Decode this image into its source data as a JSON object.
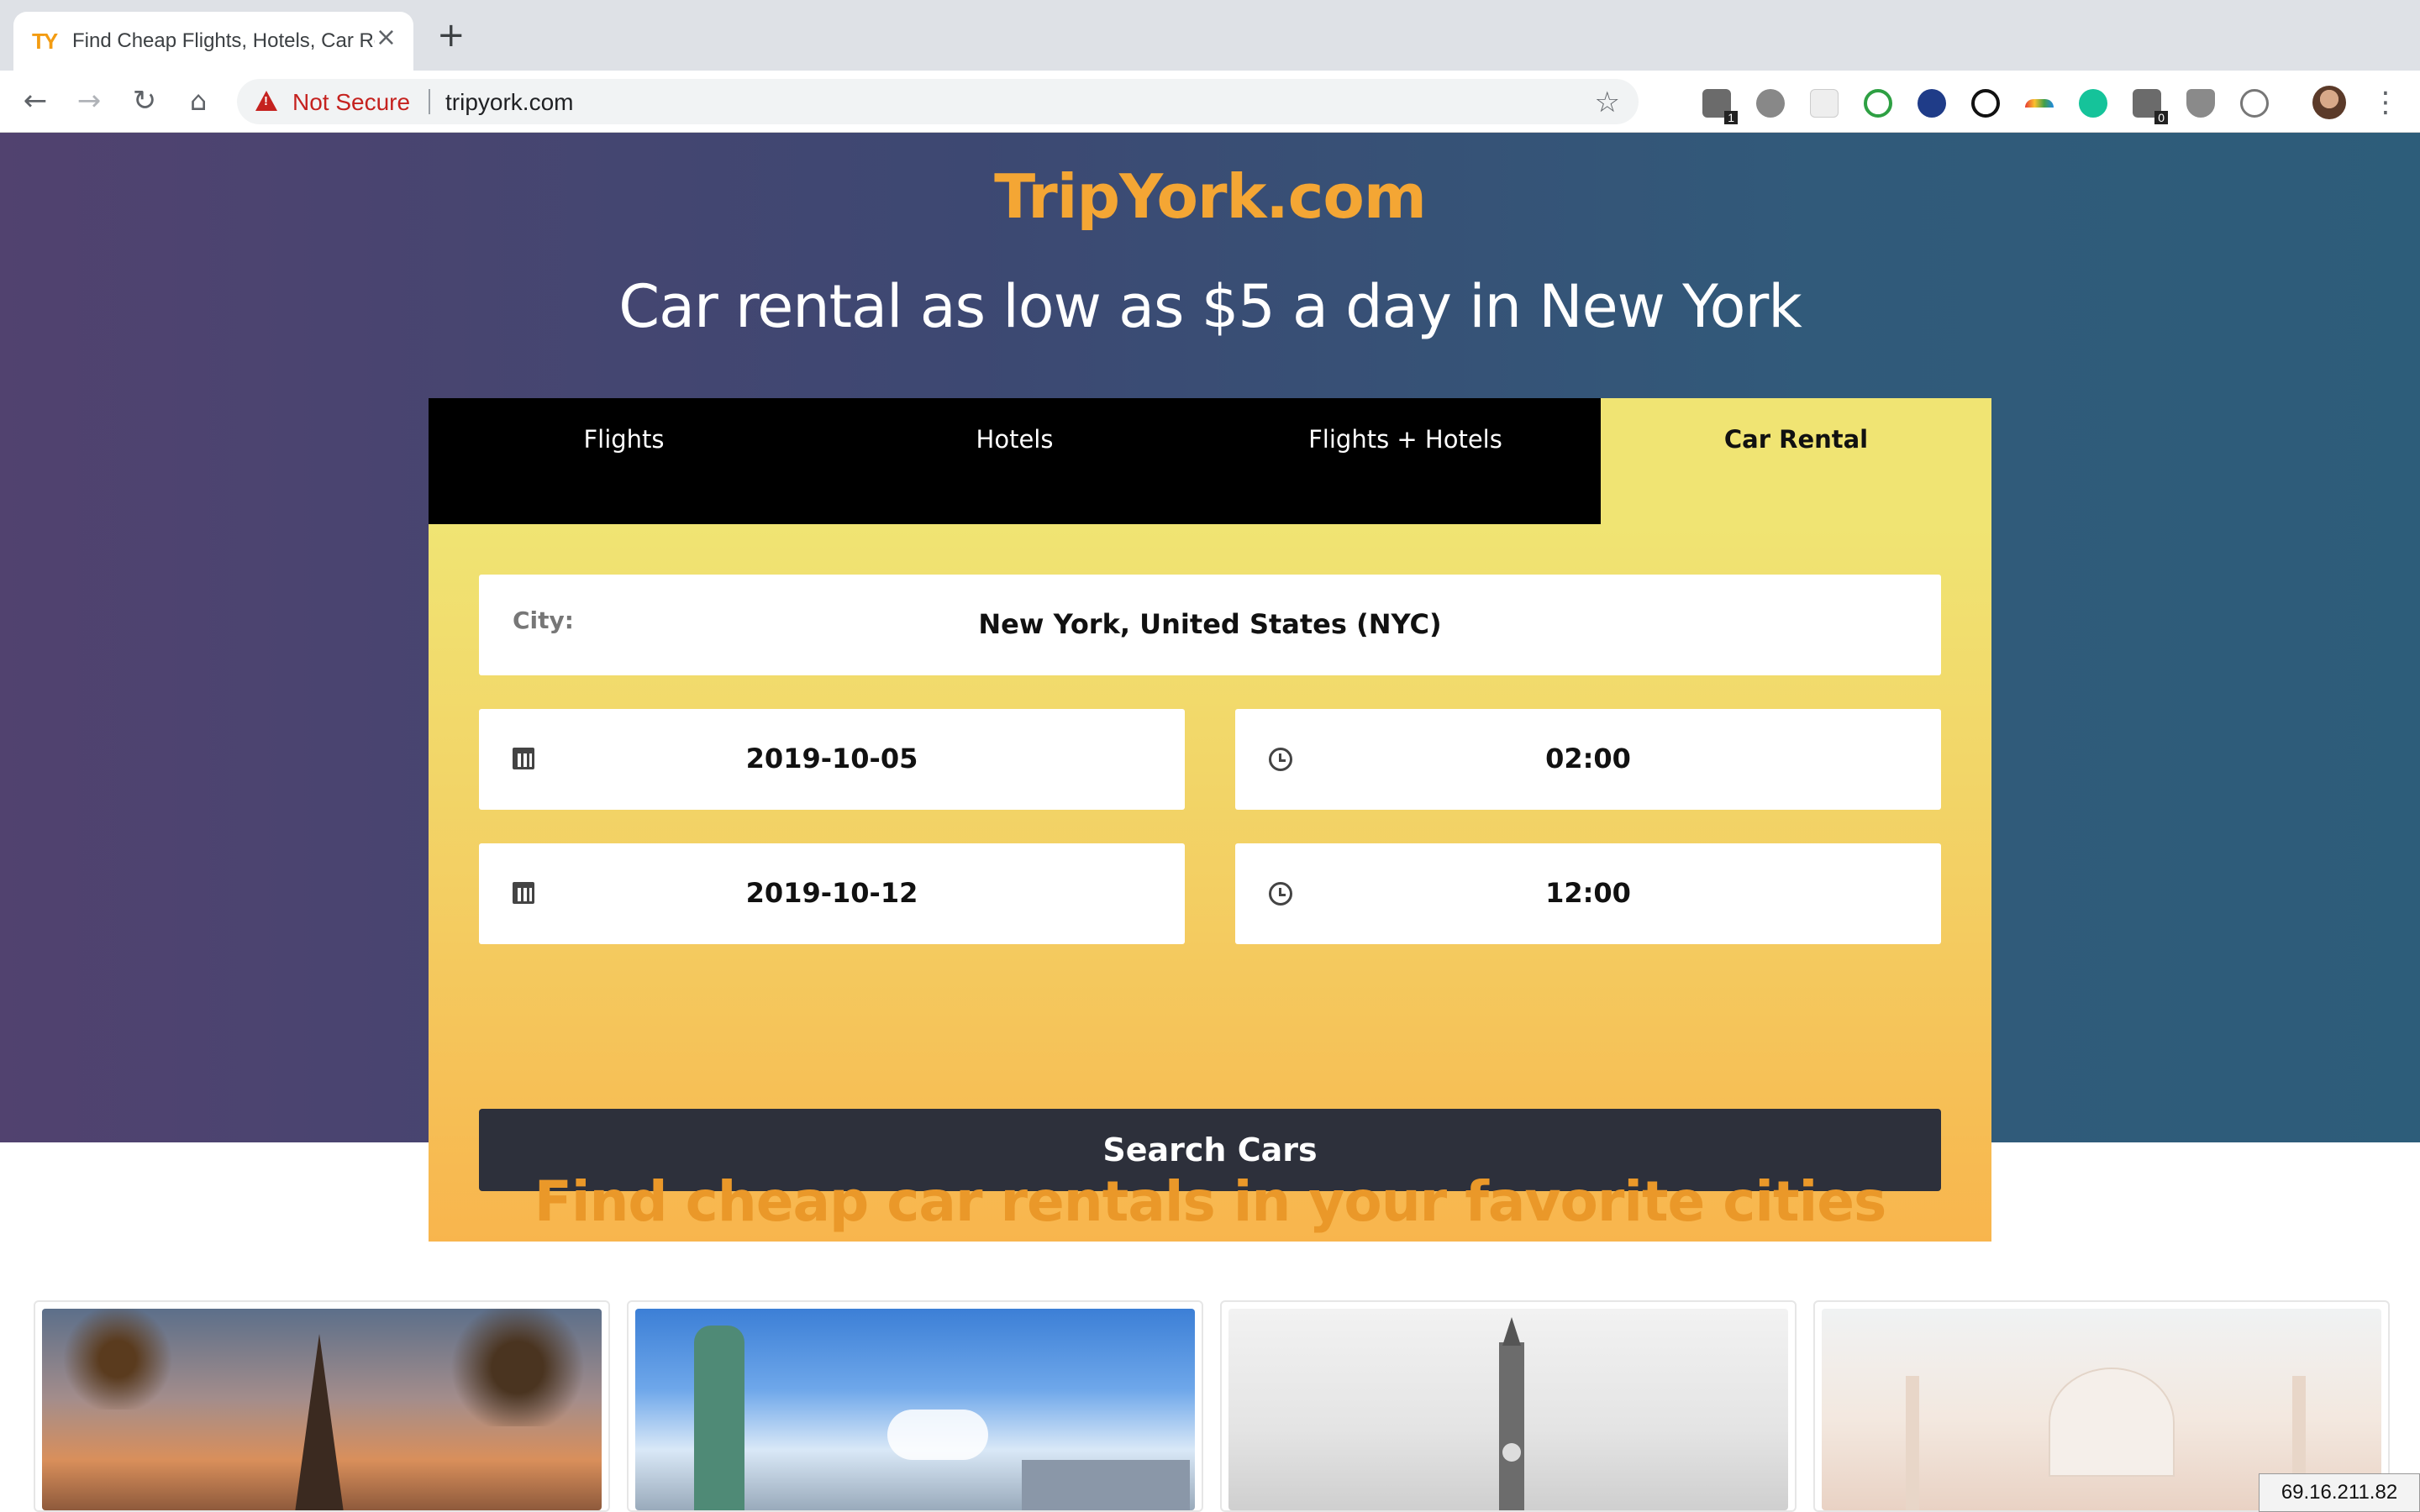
{
  "browser": {
    "tab_title": "Find Cheap Flights, Hotels, Car Rentals",
    "tab_favicon_text": "TY",
    "tab_close": "×",
    "new_tab": "+",
    "security_label": "Not Secure",
    "url": "tripyork.com",
    "extension_badges": [
      "1",
      "0"
    ]
  },
  "hero": {
    "brand": "TripYork.com",
    "headline": "Car rental as low as $5 a day in New York",
    "tabs": [
      {
        "label": "Flights",
        "active": false
      },
      {
        "label": "Hotels",
        "active": false
      },
      {
        "label": "Flights + Hotels",
        "active": false
      },
      {
        "label": "Car Rental",
        "active": true
      }
    ],
    "form": {
      "city_label": "City:",
      "city_value": "New York, United States (NYC)",
      "pickup_date": "2019-10-05",
      "pickup_time": "02:00",
      "dropoff_date": "2019-10-12",
      "dropoff_time": "12:00",
      "search_label": "Search Cars"
    }
  },
  "section": {
    "title": "Find cheap car rentals in your favorite cities"
  },
  "cities": [
    {
      "name": "paris-eiffel-tower"
    },
    {
      "name": "new-york-statue-of-liberty"
    },
    {
      "name": "london-big-ben"
    },
    {
      "name": "agra-taj-mahal"
    }
  ],
  "overlay": {
    "ip": "69.16.211.82"
  },
  "colors": {
    "brand_orange": "#f4a634",
    "title_orange": "#ea9829",
    "panel_yellow": "#f0e473",
    "button_dark": "#2d303b",
    "warning_red": "#c5221f"
  }
}
